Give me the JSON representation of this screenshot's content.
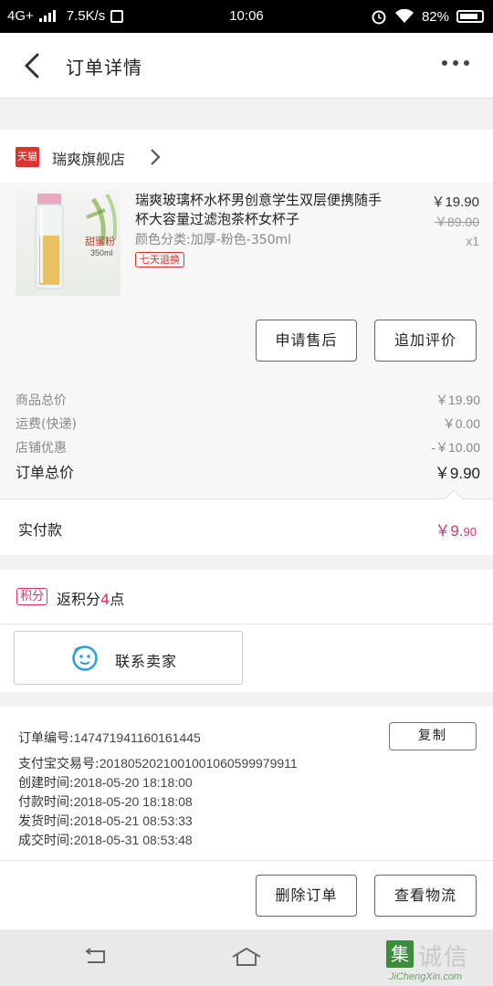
{
  "status_bar": {
    "network": "4G+",
    "speed": "7.5K/s",
    "time": "10:06",
    "battery": "82%"
  },
  "header": {
    "title": "订单详情"
  },
  "shop": {
    "badge": "天猫",
    "name": "瑞爽旗舰店"
  },
  "product": {
    "title": "瑞爽玻璃杯水杯男创意学生双层便携随手杯大容量过滤泡茶杯女杯子",
    "sku": "颜色分类:加厚-粉色-350ml",
    "tag": "七天退换",
    "price": "￥19.90",
    "original_price": "￥89.00",
    "quantity": "x1",
    "image_label": "甜蜜粉",
    "image_capacity": "350ml"
  },
  "actions": {
    "after_sale": "申请售后",
    "add_review": "追加评价",
    "delete_order": "删除订单",
    "view_logistics": "查看物流"
  },
  "totals": {
    "rows": [
      {
        "label": "商品总价",
        "value": "￥19.90"
      },
      {
        "label": "运费(快递)",
        "value": "￥0.00"
      },
      {
        "label": "店铺优惠",
        "value": "-￥10.00"
      }
    ],
    "order_total_label": "订单总价",
    "order_total_value": "￥9.90",
    "paid_label": "实付款",
    "paid_main": "￥9.",
    "paid_decimal": "90"
  },
  "points": {
    "tag": "积分",
    "prefix": "返积分",
    "count": "4",
    "suffix": "点"
  },
  "contact": {
    "label": "联系卖家"
  },
  "order_info": {
    "copy_label": "复制",
    "rows": [
      {
        "label": "订单编号:",
        "value": "147471941160161445"
      },
      {
        "label": "支付宝交易号:",
        "value": "2018052021001001060599979911"
      },
      {
        "label": "创建时间:",
        "value": "2018-05-20 18:18:00"
      },
      {
        "label": "付款时间:",
        "value": "2018-05-20 18:18:08"
      },
      {
        "label": "发货时间:",
        "value": "2018-05-21 08:53:33"
      },
      {
        "label": "成交时间:",
        "value": "2018-05-31 08:53:48"
      }
    ]
  },
  "watermark": {
    "box": "集",
    "text": "诚信",
    "url": "JiChengXin.com"
  },
  "colors": {
    "accent_pink": "#e0306a",
    "tmall_red": "#e0312d"
  }
}
